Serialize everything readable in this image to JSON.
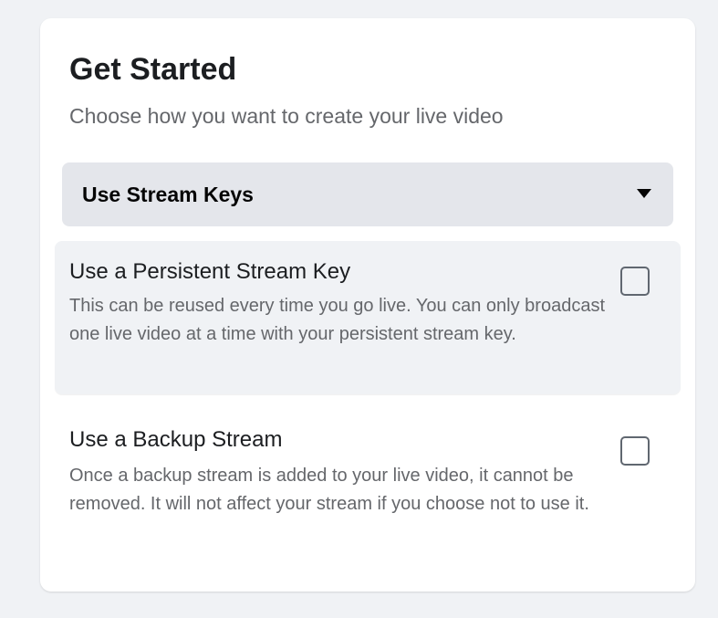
{
  "header": {
    "title": "Get Started",
    "subtitle": "Choose how you want to create your live video"
  },
  "dropdown": {
    "selected": "Use Stream Keys",
    "icon": "caret-down-icon"
  },
  "options": [
    {
      "title": "Use a Persistent Stream Key",
      "description": "This can be reused every time you go live. You can only broadcast one live video at a time with your persistent stream key.",
      "checked": false
    },
    {
      "title": "Use a Backup Stream",
      "description": "Once a backup stream is added to your live video, it cannot be removed. It will not affect your stream if you choose not to use it.",
      "checked": false
    }
  ],
  "colors": {
    "page_background": "#f0f2f5",
    "card_background": "#ffffff",
    "dropdown_background": "#e4e6eb",
    "primary_text": "#1c1e21",
    "secondary_text": "#65676b"
  }
}
